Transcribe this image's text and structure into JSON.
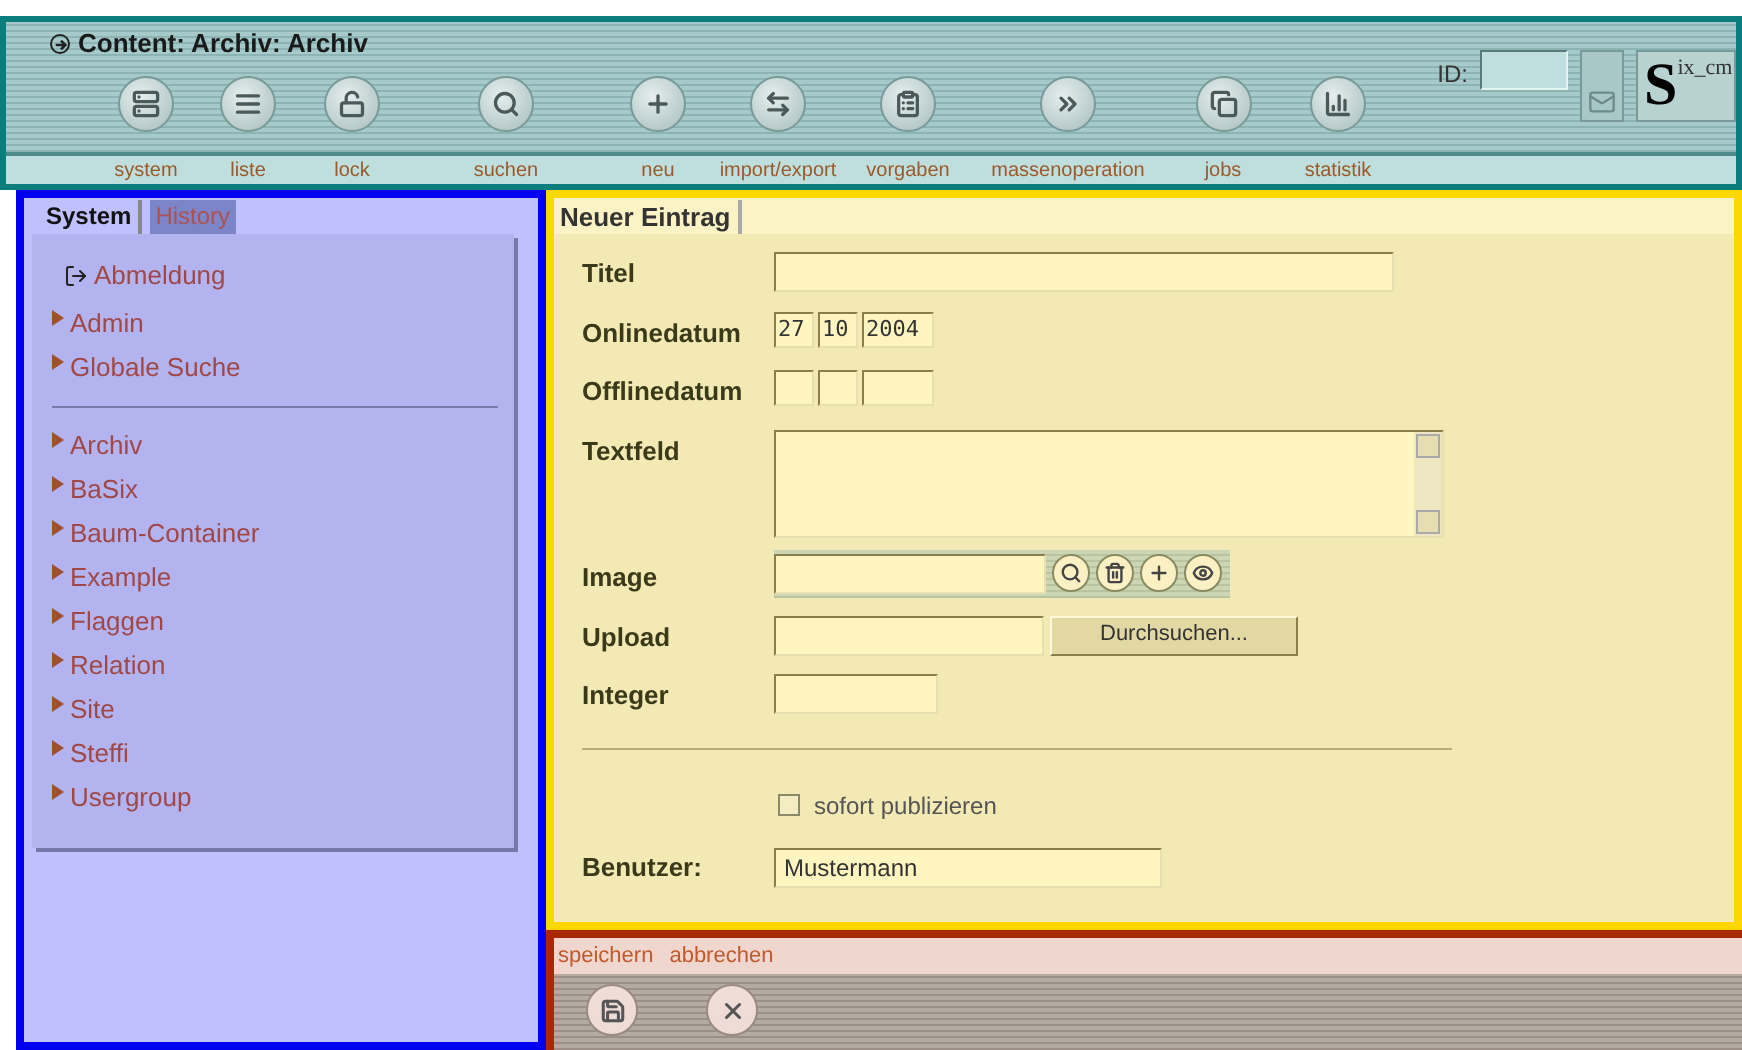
{
  "header": {
    "title": "Content: Archiv: Archiv",
    "id_label": "ID:",
    "logo": {
      "initial": "S",
      "rest": "ix_cm"
    }
  },
  "toolbar": [
    {
      "label": "system"
    },
    {
      "label": "liste"
    },
    {
      "label": "lock"
    },
    {
      "label": "suchen"
    },
    {
      "label": "neu"
    },
    {
      "label": "import/export"
    },
    {
      "label": "vorgaben"
    },
    {
      "label": "massenoperation"
    },
    {
      "label": "jobs"
    },
    {
      "label": "statistik"
    }
  ],
  "sidebar": {
    "tabs": [
      {
        "label": "System",
        "selected": true
      },
      {
        "label": "History",
        "selected": false
      }
    ],
    "groups": [
      [
        {
          "label": "Abmeldung",
          "kind": "logout"
        },
        {
          "label": "Admin",
          "kind": "link"
        },
        {
          "label": "Globale Suche",
          "kind": "link"
        }
      ],
      [
        {
          "label": "Archiv",
          "kind": "link"
        },
        {
          "label": "BaSix",
          "kind": "link"
        },
        {
          "label": "Baum-Container",
          "kind": "link"
        },
        {
          "label": "Example",
          "kind": "link"
        },
        {
          "label": "Flaggen",
          "kind": "link"
        },
        {
          "label": "Relation",
          "kind": "link"
        },
        {
          "label": "Site",
          "kind": "link"
        },
        {
          "label": "Steffi",
          "kind": "link"
        },
        {
          "label": "Usergroup",
          "kind": "link"
        }
      ]
    ]
  },
  "form": {
    "tab": "Neuer Eintrag",
    "fields": [
      {
        "label": "Titel",
        "kind": "text"
      },
      {
        "label": "Onlinedatum",
        "kind": "date",
        "parts": [
          "27",
          "10",
          "2004"
        ]
      },
      {
        "label": "Offlinedatum",
        "kind": "date"
      },
      {
        "label": "Textfeld",
        "kind": "textarea"
      },
      {
        "label": "Image",
        "kind": "image"
      },
      {
        "label": "Upload",
        "kind": "upload",
        "button": "Durchsuchen..."
      },
      {
        "label": "Integer",
        "kind": "integer"
      }
    ],
    "publish": {
      "label": "sofort publizieren",
      "checked": false
    },
    "user": {
      "label": "Benutzer:",
      "value": "Mustermann"
    }
  },
  "footer": {
    "actions": [
      {
        "label": "speichern"
      },
      {
        "label": "abbrechen"
      }
    ]
  }
}
